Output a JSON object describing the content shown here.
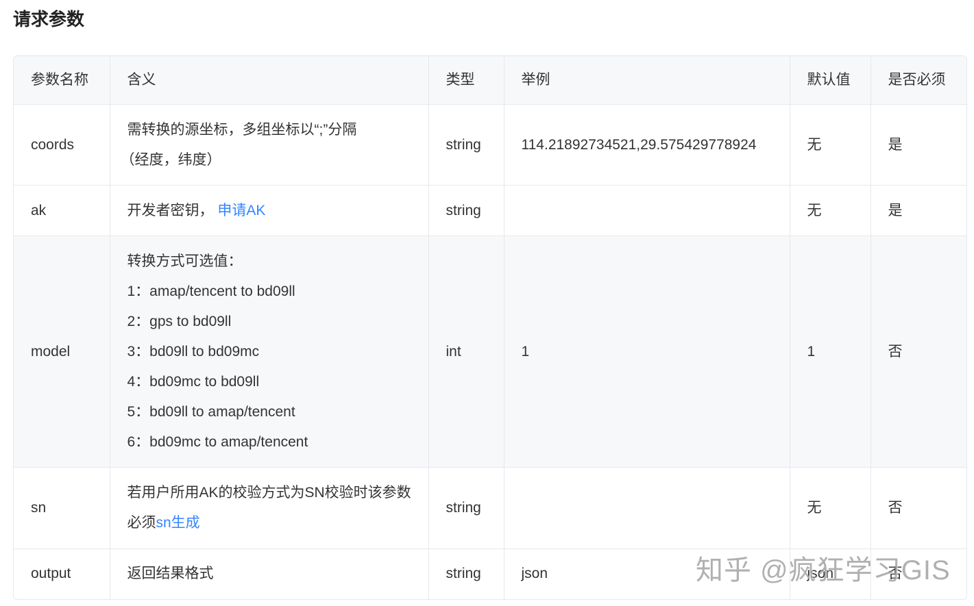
{
  "title": "请求参数",
  "columns": [
    "参数名称",
    "含义",
    "类型",
    "举例",
    "默认值",
    "是否必须"
  ],
  "rows": [
    {
      "name": "coords",
      "desc": [
        "需转换的源坐标，多组坐标以“;”分隔",
        "（经度，纬度）"
      ],
      "type": "string",
      "example": "114.21892734521,29.575429778924",
      "default": "无",
      "required": "是"
    },
    {
      "name": "ak",
      "desc_text": "开发者密钥，",
      "desc_link": "申请AK",
      "type": "string",
      "example": "",
      "default": "无",
      "required": "是"
    },
    {
      "name": "model",
      "desc": [
        "转换方式可选值：",
        "1：amap/tencent to bd09ll",
        "2：gps to bd09ll",
        "3：bd09ll to bd09mc",
        "4：bd09mc to bd09ll",
        "5：bd09ll to amap/tencent",
        "6：bd09mc to amap/tencent"
      ],
      "type": "int",
      "example": "1",
      "default": "1",
      "required": "否"
    },
    {
      "name": "sn",
      "desc_text": "若用户所用AK的校验方式为SN校验时该参数必须",
      "desc_link": "sn生成",
      "type": "string",
      "example": "",
      "default": "无",
      "required": "否"
    },
    {
      "name": "output",
      "desc": [
        "返回结果格式"
      ],
      "type": "string",
      "example": "json",
      "default": "json",
      "required": "否"
    }
  ],
  "watermark": "知乎 @疯狂学习GIS",
  "colors": {
    "link": "#3385ff",
    "header_bg": "#f7f8fa",
    "border": "#e6e8eb"
  }
}
